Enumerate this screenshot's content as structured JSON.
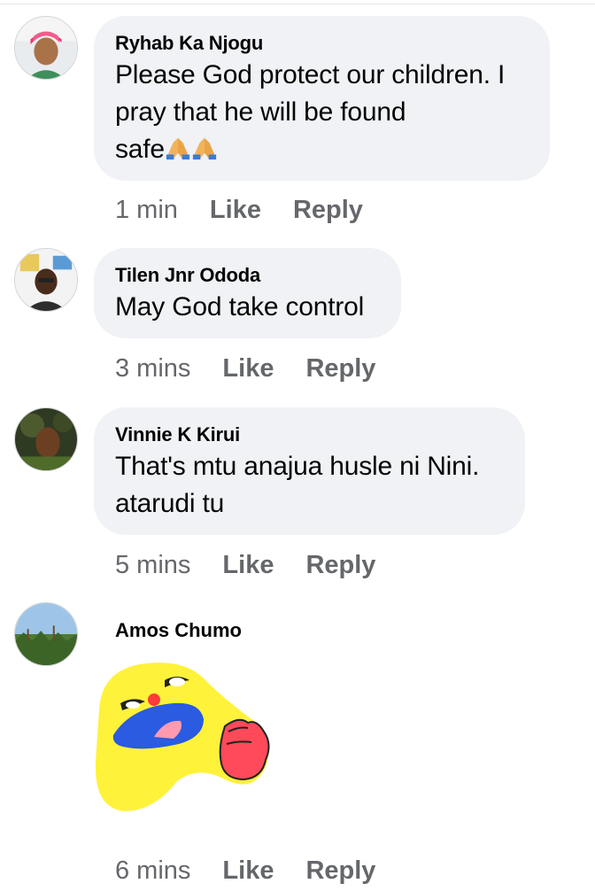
{
  "comments": [
    {
      "author": "Ryhab Ka Njogu",
      "text_lines": [
        "Please God protect our children. I",
        "pray that he will be found",
        "safe"
      ],
      "emoji": "praying-hands-emoji x2",
      "time": "1 min",
      "like_label": "Like",
      "reply_label": "Reply"
    },
    {
      "author": "Tilen Jnr Ododa",
      "text_lines": [
        "May God take control"
      ],
      "time": "3 mins",
      "like_label": "Like",
      "reply_label": "Reply"
    },
    {
      "author": "Vinnie K Kirui",
      "text_lines": [
        "That's mtu anajua husle ni Nini.",
        "atarudi tu"
      ],
      "time": "5 mins",
      "like_label": "Like",
      "reply_label": "Reply"
    },
    {
      "author": "Amos Chumo",
      "attachment": "laughing-yellow-blob-sticker",
      "time": "6 mins",
      "like_label": "Like",
      "reply_label": "Reply"
    }
  ],
  "colors": {
    "bubble": "#f0f2f5",
    "meta_text": "#65676b",
    "text": "#050505"
  }
}
